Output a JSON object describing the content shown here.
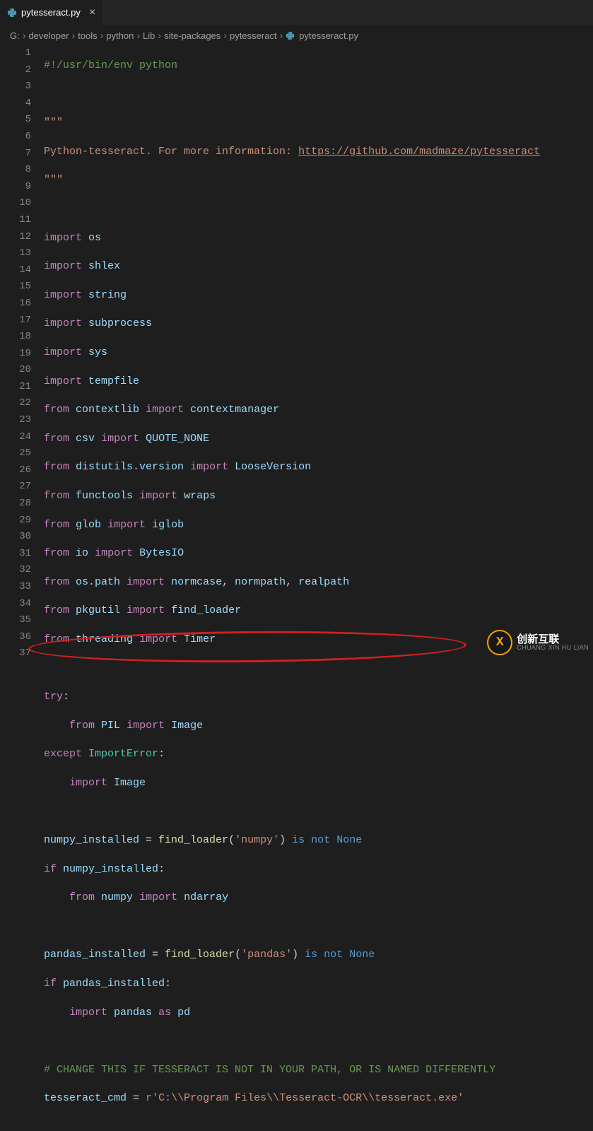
{
  "tab": {
    "filename": "pytesseract.py",
    "close": "×"
  },
  "breadcrumbs": {
    "root": "G:",
    "parts": [
      "developer",
      "tools",
      "python",
      "Lib",
      "site-packages",
      "pytesseract"
    ],
    "file": "pytesseract.py",
    "sep": "›"
  },
  "gutter": {
    "start": 1,
    "end": 37
  },
  "code": {
    "l1_shebang": "#!/usr/bin/env python",
    "l3_docq": "\"\"\"",
    "l4_doc_text": "Python-tesseract. For more information: ",
    "l4_doc_link": "https://github.com/madmaze/pytesseract",
    "l5_docq": "\"\"\"",
    "kw_import": "import",
    "kw_from": "from",
    "kw_try": "try",
    "kw_except": "except",
    "kw_if": "if",
    "kw_is": "is",
    "kw_not": "not",
    "kw_as": "as",
    "const_none": "None",
    "mod_os": "os",
    "mod_shlex": "shlex",
    "mod_string": "string",
    "mod_subprocess": "subprocess",
    "mod_sys": "sys",
    "mod_tempfile": "tempfile",
    "mod_contextlib": "contextlib",
    "name_contextmanager": "contextmanager",
    "mod_csv": "csv",
    "name_quote_none": "QUOTE_NONE",
    "mod_distutils_version": "distutils.version",
    "name_looseversion": "LooseVersion",
    "mod_functools": "functools",
    "name_wraps": "wraps",
    "mod_glob": "glob",
    "name_iglob": "iglob",
    "mod_io": "io",
    "name_bytesio": "BytesIO",
    "mod_os_path": "os.path",
    "name_normcase": "normcase",
    "name_normpath": "normpath",
    "name_realpath": "realpath",
    "mod_pkgutil": "pkgutil",
    "name_find_loader": "find_loader",
    "mod_threading": "threading",
    "name_timer": "Timer",
    "mod_pil": "PIL",
    "name_image": "Image",
    "exc_importerror": "ImportError",
    "var_numpy_installed": "numpy_installed",
    "fn_find_loader": "find_loader",
    "str_numpy": "'numpy'",
    "mod_numpy": "numpy",
    "name_ndarray": "ndarray",
    "var_pandas_installed": "pandas_installed",
    "str_pandas": "'pandas'",
    "mod_pandas": "pandas",
    "alias_pd": "pd",
    "l36_comment": "# CHANGE THIS IF TESSERACT IS NOT IN YOUR PATH, OR IS NAMED DIFFERENTLY",
    "var_tesseract_cmd": "tesseract_cmd",
    "l37_rprefix": "r",
    "l37_string": "'C:\\\\Program Files\\\\Tesseract-OCR\\\\tesseract.exe'",
    "eq": " = ",
    "colon": ":",
    "comma": ", ",
    "lparen": "(",
    "rparen": ")",
    "sp": " "
  },
  "watermark": {
    "glyph": "X",
    "cn": "创新互联",
    "en": "CHUANG XIN HU LIAN"
  }
}
